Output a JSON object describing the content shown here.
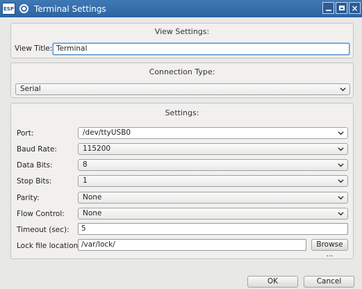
{
  "window": {
    "title": "Terminal Settings",
    "app_badge": "ESP",
    "controls": {
      "minimize": "minimize-icon",
      "maximize": "maximize-icon",
      "close": "×"
    }
  },
  "view_settings": {
    "heading": "View Settings:",
    "title_label": "View Title:",
    "title_value": "Terminal"
  },
  "connection": {
    "heading": "Connection Type:",
    "type_value": "Serial"
  },
  "settings": {
    "heading": "Settings:",
    "port_label": "Port:",
    "port_value": "/dev/ttyUSB0",
    "baud_label": "Baud Rate:",
    "baud_value": "115200",
    "databits_label": "Data Bits:",
    "databits_value": "8",
    "stopbits_label": "Stop Bits:",
    "stopbits_value": "1",
    "parity_label": "Parity:",
    "parity_value": "None",
    "flow_label": "Flow Control:",
    "flow_value": "None",
    "timeout_label": "Timeout (sec):",
    "timeout_value": "5",
    "lock_label": "Lock file location:",
    "lock_value": "/var/lock/",
    "browse_label": "Browse ..."
  },
  "footer": {
    "ok_label": "OK",
    "cancel_label": "Cancel"
  }
}
